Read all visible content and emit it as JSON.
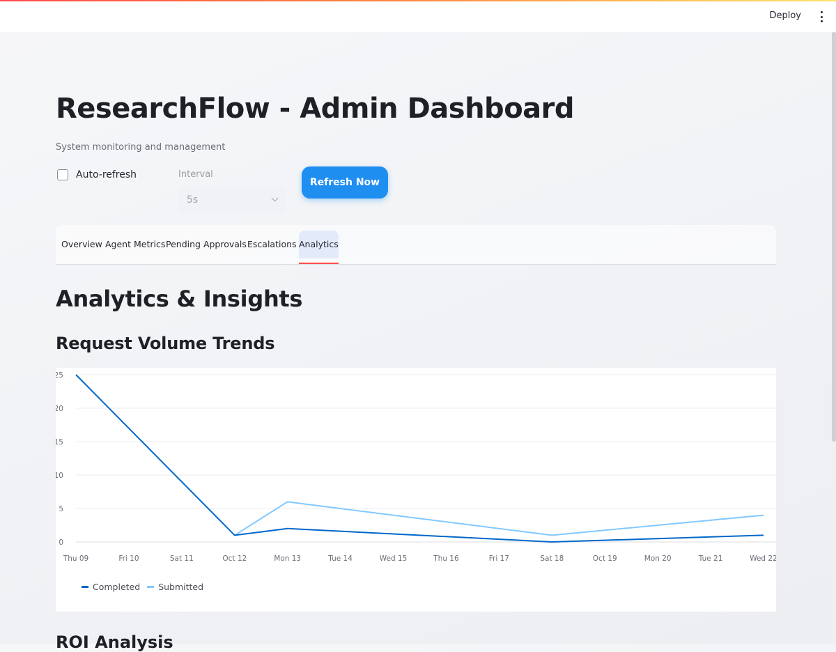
{
  "header": {
    "deploy_label": "Deploy",
    "menu_icon": "more-vert-icon"
  },
  "page": {
    "title": "ResearchFlow - Admin Dashboard",
    "subtitle": "System monitoring and management"
  },
  "controls": {
    "auto_refresh_label": "Auto-refresh",
    "auto_refresh_checked": false,
    "interval_label": "Interval",
    "interval_value": "5s",
    "refresh_button": "Refresh Now"
  },
  "tabs": [
    {
      "label": "Overview",
      "active": false
    },
    {
      "label": "Agent Metrics",
      "active": false
    },
    {
      "label": "Pending Approvals",
      "active": false
    },
    {
      "label": "Escalations",
      "active": false
    },
    {
      "label": "Analytics",
      "active": true
    }
  ],
  "analytics": {
    "section_title": "Analytics & Insights",
    "chart_title": "Request Volume Trends",
    "next_section_title": "ROI Analysis"
  },
  "chart_data": {
    "type": "line",
    "title": "Request Volume Trends",
    "x": [
      "Thu 09",
      "Fri 10",
      "Sat 11",
      "Oct 12",
      "Mon 13",
      "Tue 14",
      "Wed 15",
      "Thu 16",
      "Fri 17",
      "Sat 18",
      "Oct 19",
      "Mon 20",
      "Tue 21",
      "Wed 22"
    ],
    "series": [
      {
        "name": "Completed",
        "color": "#0068c9",
        "points": [
          {
            "x": "Thu 09",
            "y": 25
          },
          {
            "x": "Oct 12",
            "y": 1
          },
          {
            "x": "Mon 13",
            "y": 2
          },
          {
            "x": "Sat 18",
            "y": 0
          },
          {
            "x": "Wed 22",
            "y": 1
          }
        ]
      },
      {
        "name": "Submitted",
        "color": "#83c9ff",
        "points": [
          {
            "x": "Oct 12",
            "y": 1
          },
          {
            "x": "Mon 13",
            "y": 6
          },
          {
            "x": "Sat 18",
            "y": 1
          },
          {
            "x": "Wed 22",
            "y": 4
          }
        ]
      }
    ],
    "yticks": [
      0,
      5,
      10,
      15,
      20,
      25
    ],
    "ylim": [
      0,
      25
    ],
    "grid": true,
    "legend_position": "bottom-left"
  }
}
